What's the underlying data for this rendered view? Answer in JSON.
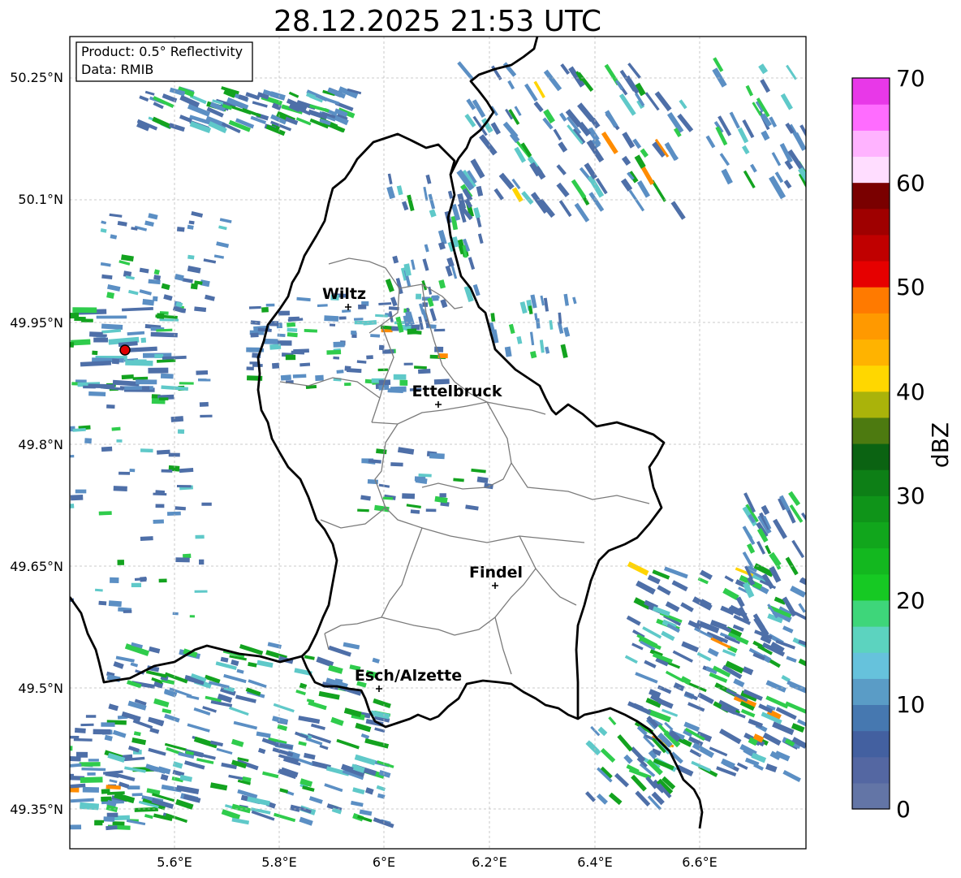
{
  "title": "28.12.2025 21:53 UTC",
  "info_box": {
    "product": "Product: 0.5° Reflectivity",
    "data": "Data: RMIB"
  },
  "axes": {
    "lon_ticks": [
      "5.6°E",
      "5.8°E",
      "6°E",
      "6.2°E",
      "6.4°E",
      "6.6°E"
    ],
    "lat_ticks": [
      "50.25°N",
      "50.1°N",
      "49.95°N",
      "49.8°N",
      "49.65°N",
      "49.5°N",
      "49.35°N"
    ]
  },
  "cities": [
    {
      "name": "Wiltz"
    },
    {
      "name": "Ettelbruck"
    },
    {
      "name": "Findel"
    },
    {
      "name": "Esch/Alzette"
    }
  ],
  "colorbar": {
    "label": "dBZ",
    "ticks": [
      "70",
      "60",
      "50",
      "40",
      "30",
      "20",
      "10",
      "0"
    ],
    "colors": [
      "#6375a6",
      "#5467a2",
      "#4360a0",
      "#4678b0",
      "#5a9cc6",
      "#66c2dc",
      "#5cd3bf",
      "#3ed67a",
      "#16c923",
      "#13b81f",
      "#11a61c",
      "#0f9419",
      "#0d7f16",
      "#0b6312",
      "#4d7a10",
      "#aab30a",
      "#ffd700",
      "#ffb300",
      "#ff9900",
      "#ff7a00",
      "#e60000",
      "#c00000",
      "#9f0000",
      "#7a0000",
      "#ffddff",
      "#ffb3ff",
      "#ff6cff",
      "#e838e8"
    ]
  },
  "radar_colors": {
    "weak": "#4e6fa8",
    "light": "#5b8fc4",
    "cyan": "#5fc9c9",
    "green": "#2fcc4c",
    "dgreen": "#13a31f",
    "yellow": "#ffd400",
    "orange": "#ff8c00"
  }
}
